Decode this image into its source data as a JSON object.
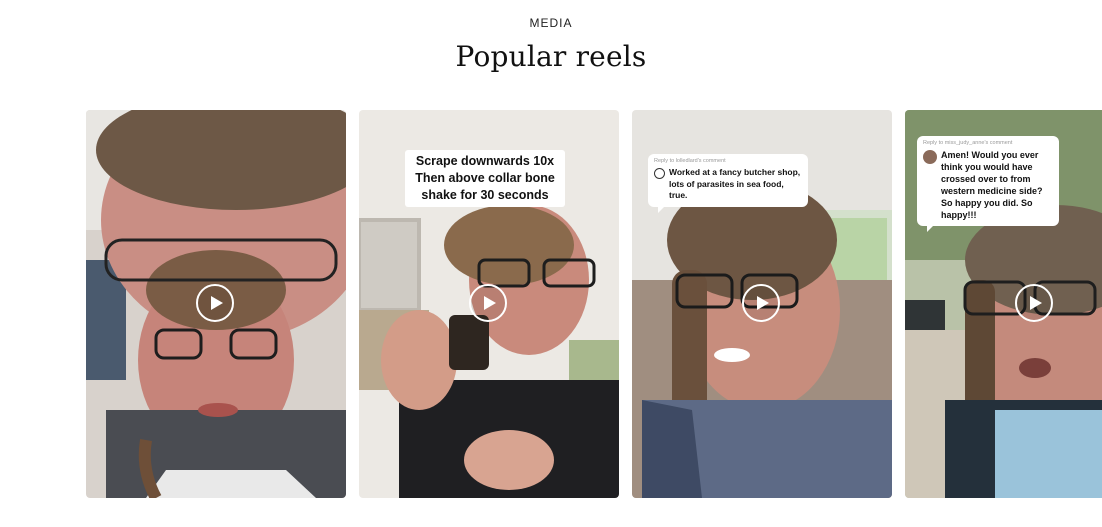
{
  "section": {
    "eyebrow": "MEDIA",
    "title": "Popular reels"
  },
  "reels": [
    {
      "id": "reel-1",
      "caption": null,
      "play_icon": "play-circle-icon"
    },
    {
      "id": "reel-2",
      "caption": "Scrape downwards 10x Then above collar bone shake for 30 seconds",
      "play_icon": "play-circle-icon"
    },
    {
      "id": "reel-3",
      "reply_to": "Reply to lolledlard's comment",
      "comment": "Worked at a fancy butcher shop, lots of parasites in sea food, true.",
      "play_icon": "play-circle-icon"
    },
    {
      "id": "reel-4",
      "reply_to": "Reply to miss_judy_anne's comment",
      "comment": "Amen! Would you ever think you would have crossed over to from western medicine side? So happy you did. So happy!!!",
      "play_icon": "play-circle-icon"
    }
  ],
  "colors": {
    "play_icon": "#ffffff",
    "caption_bg": "#ffffff",
    "page_bg": "#ffffff"
  }
}
